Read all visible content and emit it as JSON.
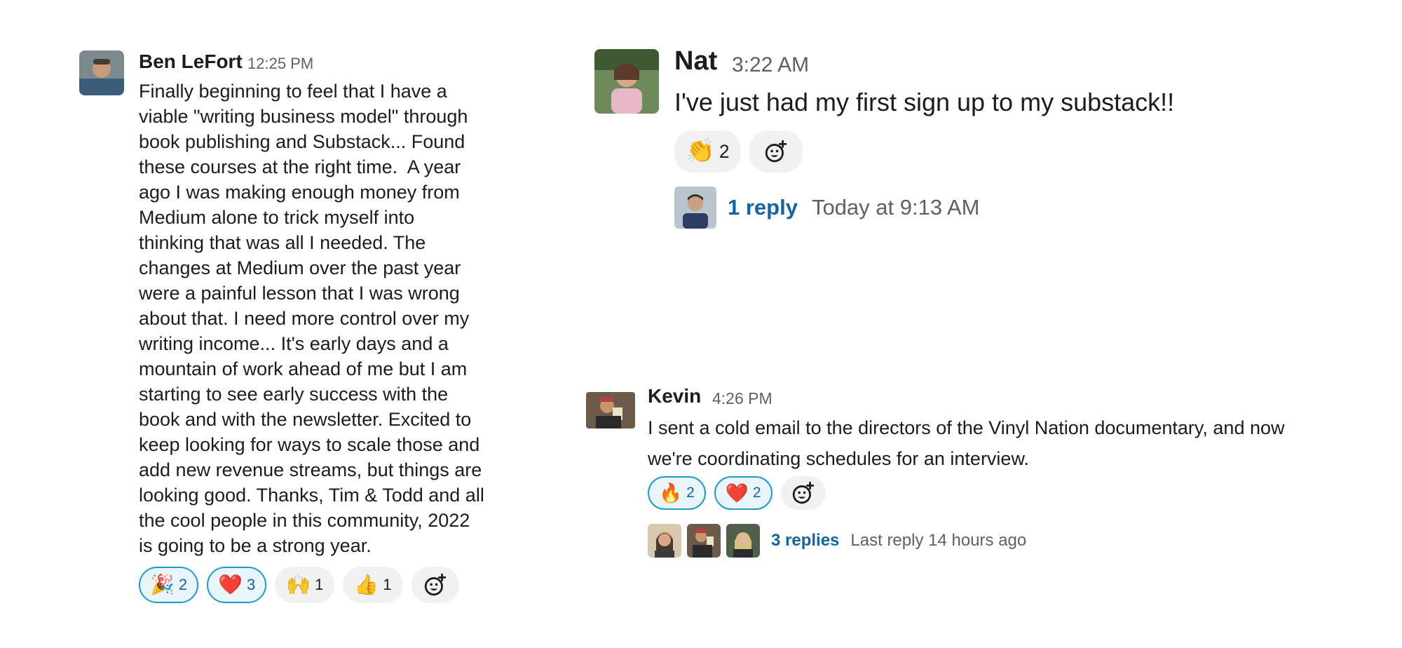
{
  "messages": {
    "ben": {
      "author": "Ben LeFort",
      "time": "12:25 PM",
      "lines": [
        "Finally beginning to feel that I have a",
        "viable \"writing business model\" through",
        "book publishing and Substack... Found",
        "these courses at the right time.  A year",
        "ago I was making enough money from",
        "Medium alone to trick myself into",
        "thinking that was all I needed. The",
        "changes at Medium over the past year",
        "were a painful lesson that I was wrong",
        "about that. I need more control over my",
        "writing income... It's early days and a",
        "mountain of work ahead of me but I am",
        "starting to see early success with the",
        "book and with the newsletter. Excited to",
        "keep looking for ways to scale those and",
        "add new revenue streams, but things are",
        "looking good. Thanks, Tim & Todd and all",
        "the cool people in this community, 2022",
        "is going to be a strong year."
      ],
      "reactions": [
        {
          "emoji": "🎉",
          "count": "2",
          "mine": true
        },
        {
          "emoji": "❤️",
          "count": "3",
          "mine": true
        },
        {
          "emoji": "🙌",
          "count": "1",
          "mine": false
        },
        {
          "emoji": "👍",
          "count": "1",
          "mine": false
        }
      ]
    },
    "nat": {
      "author": "Nat",
      "time": "3:22 AM",
      "text": "I've just had my first sign up to my substack!!",
      "reactions": [
        {
          "emoji": "👏",
          "count": "2",
          "mine": false
        }
      ],
      "thread": {
        "replies": "1 reply",
        "meta": "Today at 9:13 AM"
      }
    },
    "kevin": {
      "author": "Kevin",
      "time": "4:26 PM",
      "lines": [
        "I sent a cold email to the directors of the Vinyl Nation documentary, and now",
        "we're coordinating schedules for an interview."
      ],
      "reactions": [
        {
          "emoji": "🔥",
          "count": "2",
          "mine": true
        },
        {
          "emoji": "❤️",
          "count": "2",
          "mine": true
        }
      ],
      "thread": {
        "replies": "3 replies",
        "meta": "Last reply 14 hours ago"
      }
    }
  },
  "colors": {
    "link": "#1264a3",
    "reaction_border": "#1d9bd1",
    "muted": "#616061"
  }
}
